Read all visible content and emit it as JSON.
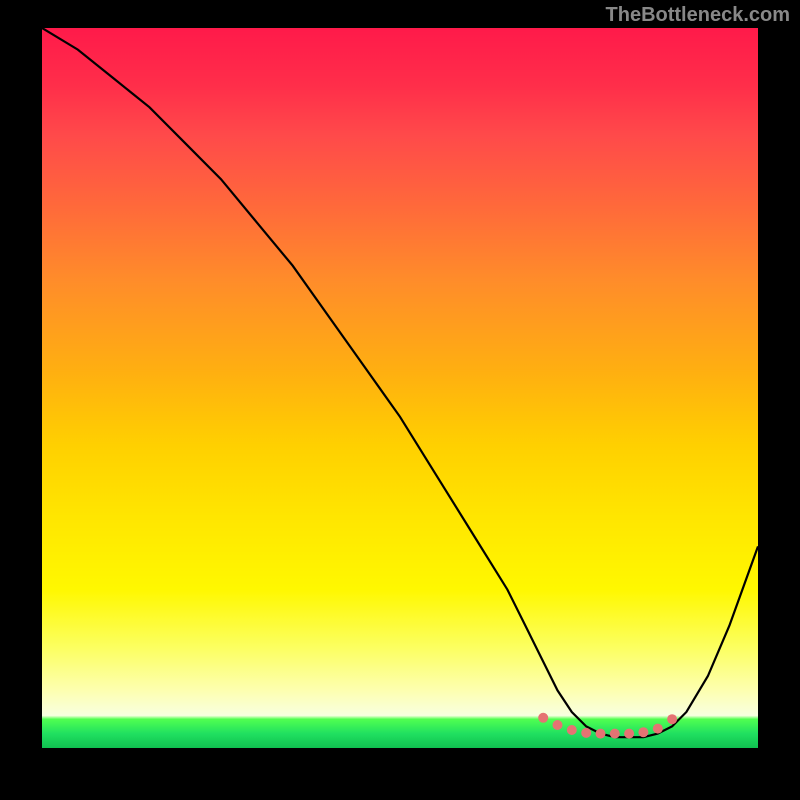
{
  "watermark": "TheBottleneck.com",
  "chart_data": {
    "type": "line",
    "title": "",
    "xlabel": "",
    "ylabel": "",
    "xlim": [
      0,
      100
    ],
    "ylim": [
      0,
      100
    ],
    "series": [
      {
        "name": "curve",
        "x": [
          0,
          5,
          10,
          15,
          20,
          25,
          30,
          35,
          40,
          45,
          50,
          55,
          60,
          65,
          68,
          70,
          72,
          74,
          76,
          78,
          80,
          82,
          84,
          86,
          88,
          90,
          93,
          96,
          100
        ],
        "values": [
          100,
          97,
          93,
          89,
          84,
          79,
          73,
          67,
          60,
          53,
          46,
          38,
          30,
          22,
          16,
          12,
          8,
          5,
          3,
          2,
          1.5,
          1.5,
          1.5,
          2,
          3,
          5,
          10,
          17,
          28
        ]
      }
    ],
    "markers": {
      "name": "dots",
      "x": [
        70,
        72,
        74,
        76,
        78,
        80,
        82,
        84,
        86,
        88
      ],
      "values": [
        4.2,
        3.2,
        2.5,
        2.1,
        2.0,
        2.0,
        2.0,
        2.2,
        2.7,
        4.0
      ]
    },
    "gradient_stops": [
      {
        "pos": 0,
        "color": "#ff1a4a"
      },
      {
        "pos": 15,
        "color": "#ff4a4a"
      },
      {
        "pos": 35,
        "color": "#ff8c2a"
      },
      {
        "pos": 58,
        "color": "#ffd000"
      },
      {
        "pos": 78,
        "color": "#fff800"
      },
      {
        "pos": 95,
        "color": "#f8ffe0"
      },
      {
        "pos": 97,
        "color": "#40f050"
      },
      {
        "pos": 100,
        "color": "#10c050"
      }
    ]
  }
}
